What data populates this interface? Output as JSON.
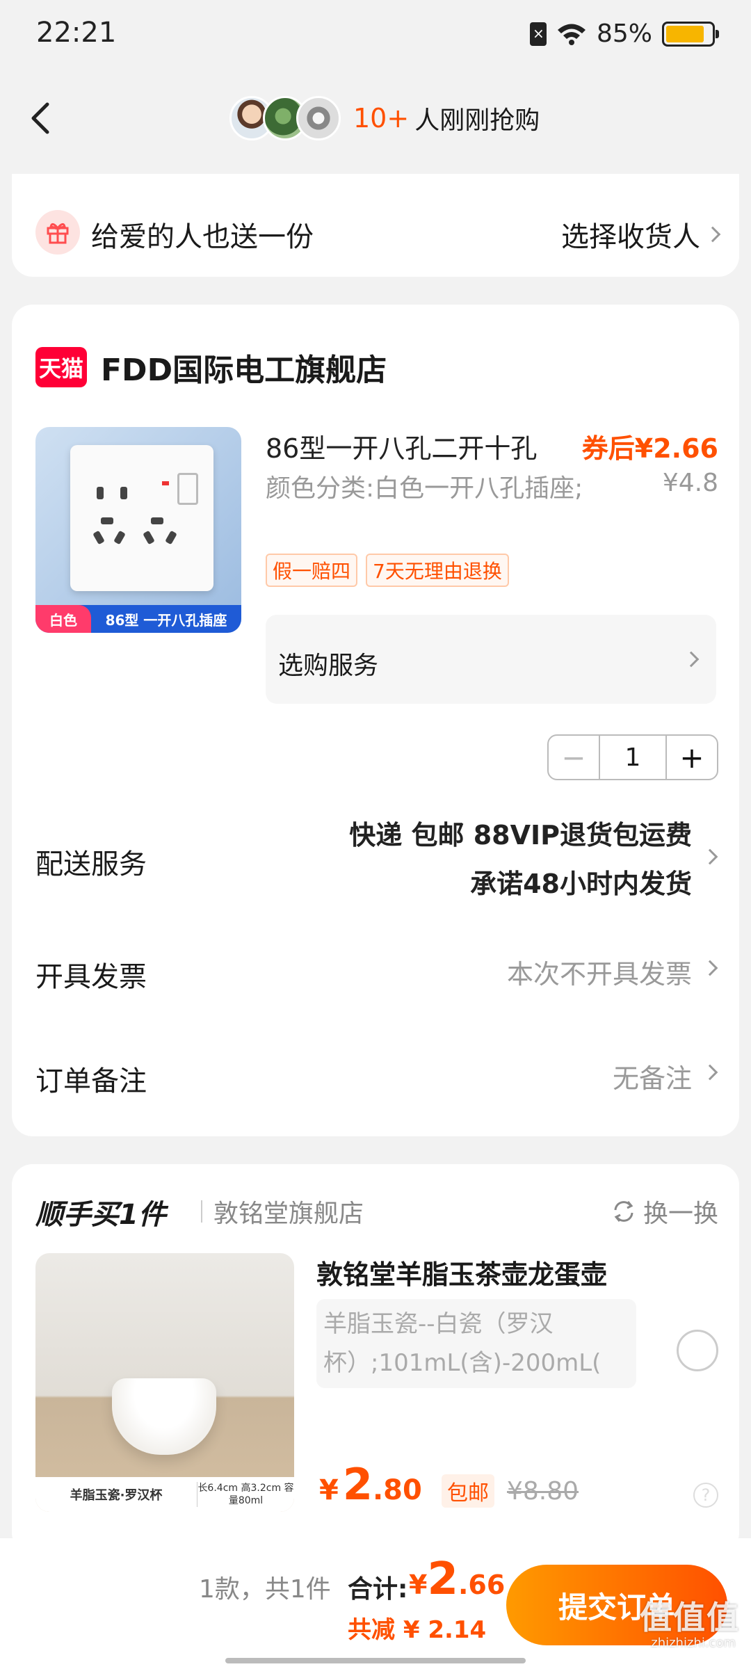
{
  "status_bar": {
    "time": "22:21",
    "battery": "85%",
    "battery_level": 0.85
  },
  "nav": {
    "buyer_count": "10+",
    "buyer_text": "人刚刚抢购"
  },
  "gift": {
    "text": "给爱的人也送一份",
    "action": "选择收货人"
  },
  "shop": {
    "badge": "天猫",
    "name": "FDD国际电工旗舰店"
  },
  "product": {
    "title": "86型一开八孔二开十孔",
    "coupon_price": "券后¥2.66",
    "original_price": "¥4.8",
    "spec": "颜色分类:白色一开八孔插座;",
    "tags": [
      "假一赔四",
      "7天无理由退换"
    ],
    "image_strip_left": "白色",
    "image_strip_right": "86型 一开八孔插座",
    "image_brand": "",
    "service_label": "选购服务",
    "quantity": "1"
  },
  "rows": {
    "delivery_label": "配送服务",
    "delivery_line1": "快递 包邮 88VIP退货包运费",
    "delivery_line2": "承诺48小时内发货",
    "invoice_label": "开具发票",
    "invoice_value": "本次不开具发票",
    "note_label": "订单备注",
    "note_value": "无备注"
  },
  "addon": {
    "title": "顺手买1件",
    "shop": "敦铭堂旗舰店",
    "swap": "换一换",
    "name": "敦铭堂羊脂玉茶壶龙蛋壶",
    "spec": "羊脂玉瓷--白瓷（罗汉杯）;101mL(含)-200mL(",
    "price_currency": "¥",
    "price_int": "2",
    "price_dec": ".80",
    "free_shipping": "包邮",
    "original_price": "¥8.80",
    "image_strip_left": "羊脂玉瓷·罗汉杯",
    "image_strip_right": "长6.4cm 高3.2cm 容量80ml"
  },
  "summary": {
    "count": "1款，共1件",
    "total_label": "合计:",
    "total_currency": "¥",
    "total_int": "2",
    "total_dec": ".66",
    "discount": "共减 ¥ 2.14",
    "submit": "提交订单"
  },
  "watermark": {
    "text": "值值值",
    "url": "zhizhizhi.com"
  },
  "colors": {
    "accent": "#ff5000",
    "tmall": "#ff0036",
    "battery": "#f7b500"
  }
}
